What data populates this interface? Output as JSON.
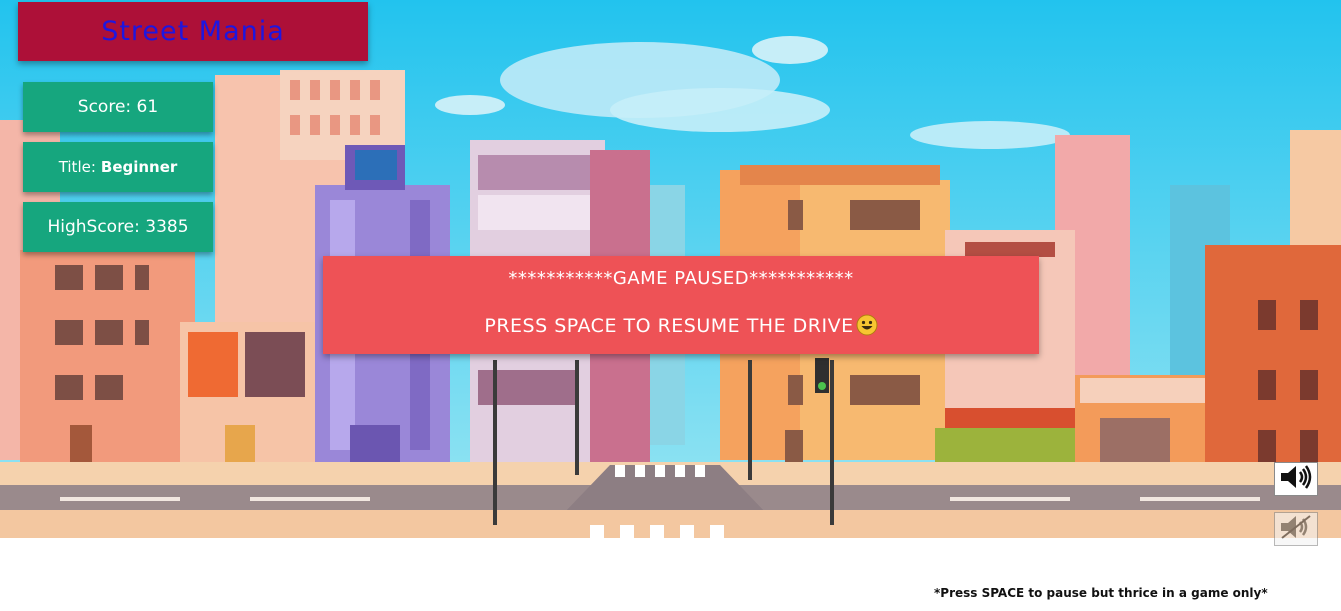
{
  "game": {
    "title": "Street Mania",
    "score_label": "Score: 61",
    "title_label": "Title:",
    "title_value": "Beginner",
    "highscore_label": "HighScore: 3385"
  },
  "pause_overlay": {
    "line1": "***********GAME PAUSED***********",
    "line2": "PRESS SPACE TO RESUME THE DRIVE",
    "emoji": "smiley-emoji"
  },
  "sound_controls": {
    "on_icon": "speaker-on-icon",
    "off_icon": "speaker-mute-icon"
  },
  "footer": {
    "note": "*Press SPACE to pause but thrice in a game only*"
  },
  "colors": {
    "title_bg": "#ad1038",
    "title_text": "#1e16e0",
    "stat_bg": "#16a67e",
    "pause_bg": "#ee5256",
    "sky": "#2bc7ec"
  }
}
